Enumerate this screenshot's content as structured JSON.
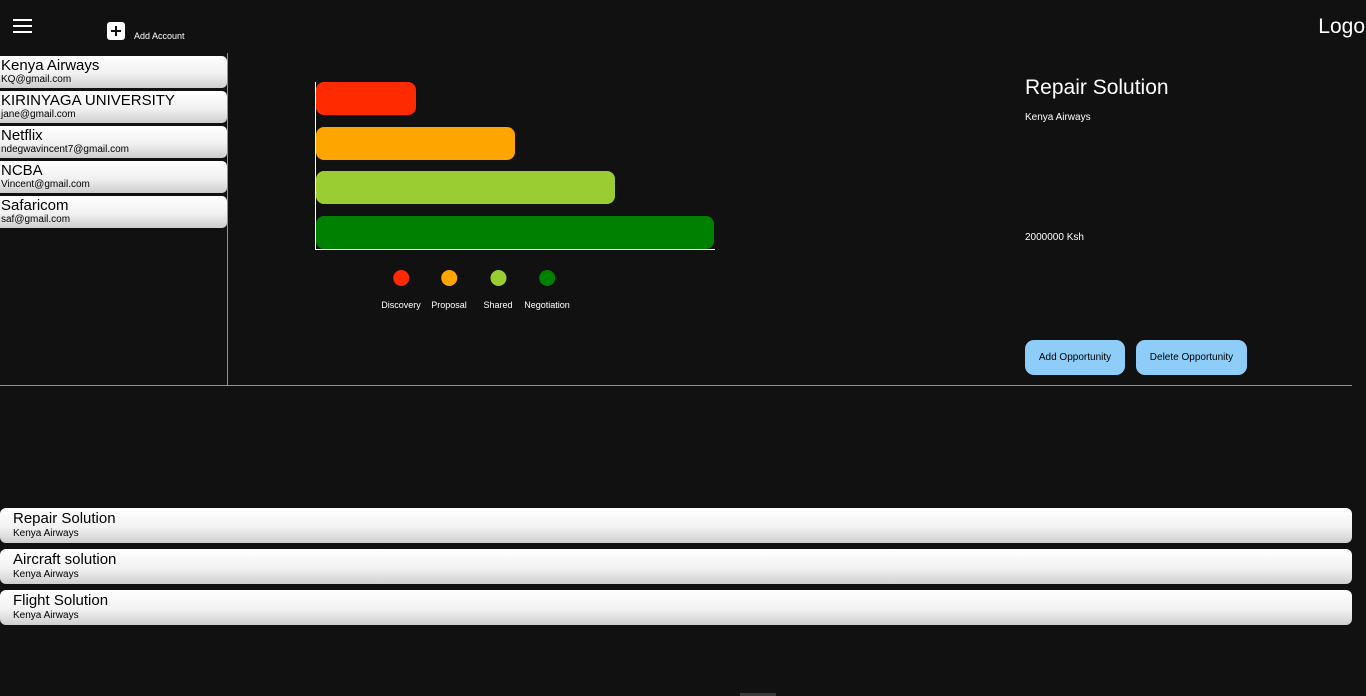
{
  "header": {
    "add_account_label": "Add Account",
    "logo_text": "Logo",
    "menu_icon": "hamburger-menu-icon",
    "add_icon": "plus-square-icon"
  },
  "accounts": [
    {
      "name": "Kenya Airways",
      "email": "KQ@gmail.com"
    },
    {
      "name": "KIRINYAGA UNIVERSITY",
      "email": "jane@gmail.com"
    },
    {
      "name": "Netflix",
      "email": "ndegwavincent7@gmail.com"
    },
    {
      "name": "NCBA",
      "email": "Vincent@gmail.com"
    },
    {
      "name": "Safaricom",
      "email": "saf@gmail.com"
    }
  ],
  "chart_data": {
    "type": "bar",
    "orientation": "horizontal",
    "categories": [
      "Discovery",
      "Proposal",
      "Shared",
      "Negotiation"
    ],
    "values": [
      1,
      2,
      3,
      4
    ],
    "xlim": [
      0,
      4
    ],
    "colors": [
      "#ff2a00",
      "#ffa500",
      "#9acd32",
      "#008000"
    ],
    "legend": [
      "Discovery",
      "Proposal",
      "Shared",
      "Negotiation"
    ],
    "legend_placement": "bottom",
    "grid": false,
    "title": "",
    "xlabel": "",
    "ylabel": ""
  },
  "detail": {
    "title": "Repair Solution",
    "account": "Kenya Airways",
    "amount": "2000000 Ksh",
    "add_button": "Add Opportunity",
    "delete_button": "Delete Opportunity"
  },
  "opportunities": [
    {
      "name": "Repair Solution",
      "account": "Kenya Airways"
    },
    {
      "name": "Aircraft solution",
      "account": "Kenya Airways"
    },
    {
      "name": "Flight Solution",
      "account": "Kenya Airways"
    }
  ],
  "colors": {
    "background": "#111111",
    "accent_line": "#4aa8dc",
    "button": "#8ecdf8"
  }
}
